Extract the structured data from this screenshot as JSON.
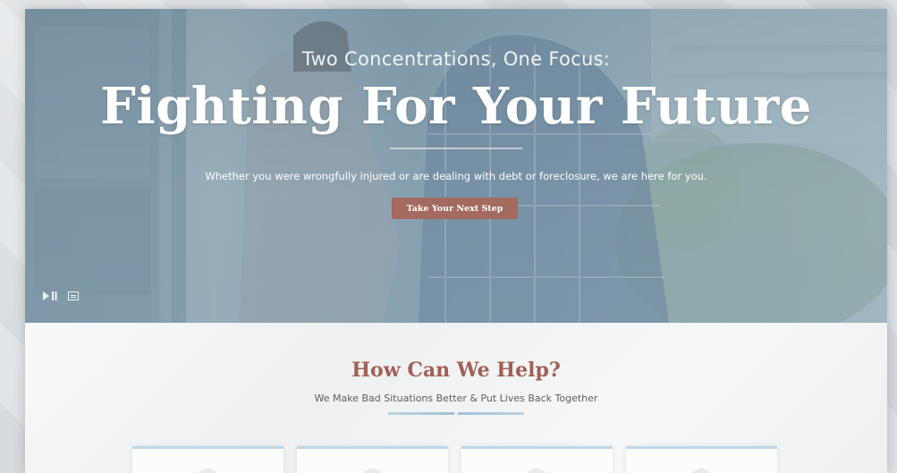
{
  "hero": {
    "eyebrow": "Two Concentrations, One Focus:",
    "title": "Fighting For Your Future",
    "subtitle": "Whether you were wrongfully injured or are dealing with debt or foreclosure, we are here for you.",
    "cta_label": "Take Your Next Step",
    "controls": {
      "play_pause_icon": "play-pause-icon",
      "captions_icon": "captions-icon"
    }
  },
  "help": {
    "title": "How Can We Help?",
    "subtitle": "We Make Bad Situations Better & Put Lives Back Together",
    "cards_count_visible": 4
  },
  "colors": {
    "accent": "#a4695f",
    "heading": "#a25f55",
    "card_border": "#bcd8ea"
  }
}
